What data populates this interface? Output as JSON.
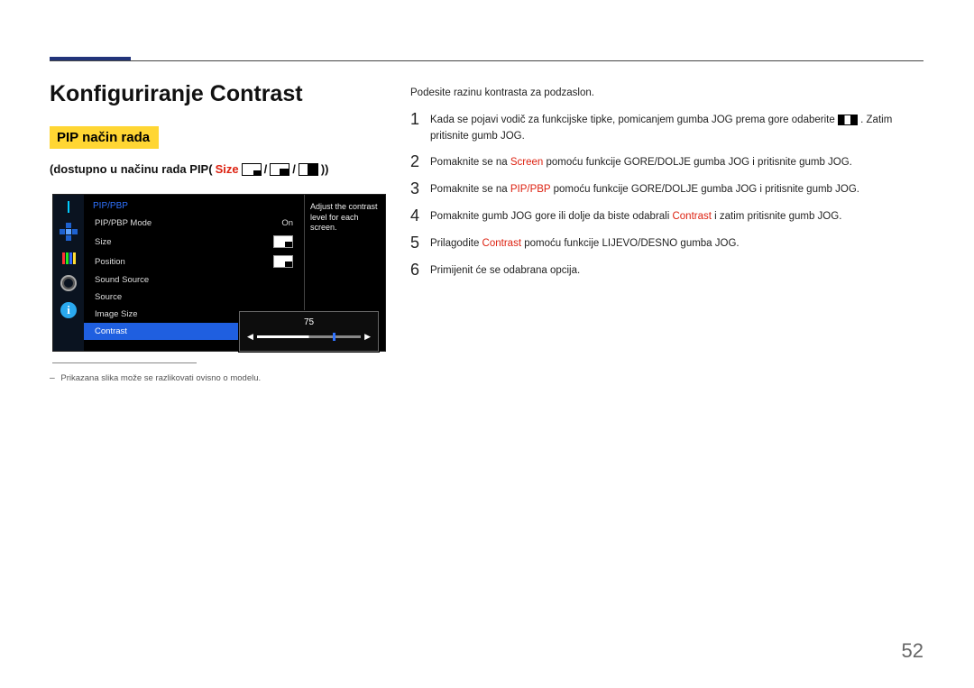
{
  "page_number": "52",
  "heading": "Konfiguriranje Contrast",
  "mode_box": "PIP način rada",
  "availability_prefix": "(dostupno u načinu rada PIP(",
  "availability_size": "Size",
  "availability_sep1": " / ",
  "availability_sep2": " / ",
  "availability_suffix": "))",
  "osd": {
    "title": "PIP/PBP",
    "items": [
      {
        "label": "PIP/PBP Mode",
        "value": "On"
      },
      {
        "label": "Size",
        "value": ""
      },
      {
        "label": "Position",
        "value": ""
      },
      {
        "label": "Sound Source",
        "value": ""
      },
      {
        "label": "Source",
        "value": ""
      },
      {
        "label": "Image Size",
        "value": ""
      },
      {
        "label": "Contrast",
        "value": ""
      }
    ],
    "help": "Adjust the contrast level for each screen.",
    "slider_value": "75"
  },
  "nav_info_glyph": "i",
  "footnote": "Prikazana slika može se razlikovati ovisno o modelu.",
  "footnote_dash": "―",
  "intro": "Podesite razinu kontrasta za podzaslon.",
  "steps": [
    {
      "n": "1",
      "pre": "Kada se pojavi vodič za funkcijske tipke, pomicanjem gumba JOG prema gore odaberite ",
      "post": ". Zatim pritisnite gumb JOG."
    },
    {
      "n": "2",
      "pre": "Pomaknite se na ",
      "kw": "Screen",
      "post": " pomoću funkcije GORE/DOLJE gumba JOG i pritisnite gumb JOG."
    },
    {
      "n": "3",
      "pre": "Pomaknite se na ",
      "kw": "PIP/PBP",
      "post": " pomoću funkcije GORE/DOLJE gumba JOG i pritisnite gumb JOG."
    },
    {
      "n": "4",
      "pre": "Pomaknite gumb JOG gore ili dolje da biste odabrali ",
      "kw": "Contrast",
      "post": " i zatim pritisnite gumb JOG."
    },
    {
      "n": "5",
      "pre": "Prilagodite ",
      "kw": "Contrast",
      "post": " pomoću funkcije LIJEVO/DESNO gumba JOG."
    },
    {
      "n": "6",
      "pre": "Primijenit će se odabrana opcija.",
      "kw": "",
      "post": ""
    }
  ]
}
